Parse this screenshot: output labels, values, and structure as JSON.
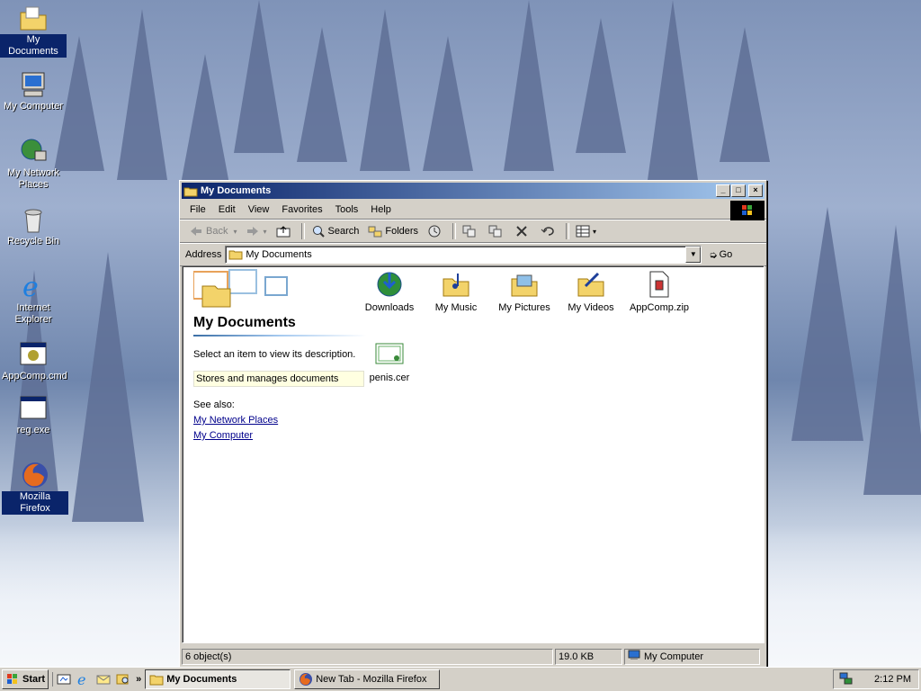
{
  "desktop": {
    "icons": [
      {
        "label": "My Documents",
        "icon": "folder-documents-icon"
      },
      {
        "label": "My Computer",
        "icon": "computer-icon"
      },
      {
        "label": "My Network Places",
        "icon": "network-icon"
      },
      {
        "label": "Recycle Bin",
        "icon": "recycle-bin-icon"
      },
      {
        "label": "Internet Explorer",
        "icon": "internet-explorer-icon"
      },
      {
        "label": "AppComp.cmd",
        "icon": "cmd-file-icon"
      },
      {
        "label": "reg.exe",
        "icon": "exe-file-icon"
      },
      {
        "label": "Mozilla Firefox",
        "icon": "firefox-icon"
      }
    ]
  },
  "window": {
    "title": "My Documents",
    "controls": {
      "minimize": "_",
      "maximize": "□",
      "close": "×"
    },
    "menu": [
      "File",
      "Edit",
      "View",
      "Favorites",
      "Tools",
      "Help"
    ],
    "toolbar": {
      "back": "Back",
      "search": "Search",
      "folders": "Folders"
    },
    "address": {
      "label": "Address",
      "value": "My Documents",
      "go": "Go"
    },
    "left_pane": {
      "heading": "My Documents",
      "description": "Select an item to view its description.",
      "info": "Stores and manages documents",
      "see_also": "See also:",
      "links": [
        "My Network Places",
        "My Computer"
      ]
    },
    "files": [
      {
        "name": "Downloads",
        "icon": "downloads-folder-icon"
      },
      {
        "name": "My Music",
        "icon": "music-folder-icon"
      },
      {
        "name": "My Pictures",
        "icon": "pictures-folder-icon"
      },
      {
        "name": "My Videos",
        "icon": "videos-folder-icon"
      },
      {
        "name": "AppComp.zip",
        "icon": "zip-file-icon"
      },
      {
        "name": "penis.cer",
        "icon": "certificate-file-icon"
      }
    ],
    "status": {
      "objects": "6 object(s)",
      "size": "19.0 KB",
      "location": "My Computer"
    }
  },
  "taskbar": {
    "start": "Start",
    "tasks": [
      {
        "label": "My Documents",
        "active": true
      },
      {
        "label": "New Tab - Mozilla Firefox",
        "active": false
      }
    ],
    "chevron": "»",
    "clock": "2:12 PM"
  },
  "colors": {
    "titlebar_start": "#0a246a",
    "titlebar_end": "#a6caf0",
    "face": "#d4d0c8",
    "link": "#00008b"
  }
}
